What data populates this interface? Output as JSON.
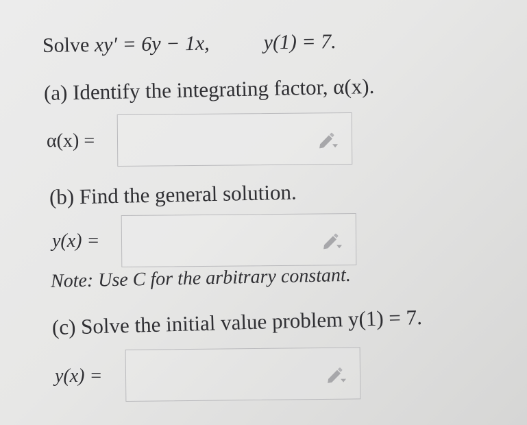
{
  "problem": {
    "prefix": "Solve ",
    "equation": "xy′ = 6y − 1x,",
    "initial_condition": "y(1) = 7."
  },
  "part_a": {
    "prompt": "(a) Identify the integrating factor, α(x).",
    "answer_label": "α(x) =",
    "answer_value": ""
  },
  "part_b": {
    "prompt": "(b) Find the general solution.",
    "answer_label": "y(x) =",
    "answer_value": "",
    "note": "Note: Use C for the arbitrary constant."
  },
  "part_c": {
    "prompt": "(c) Solve the initial value problem y(1) = 7.",
    "answer_label": "y(x) =",
    "answer_value": ""
  },
  "icons": {
    "answer_box_tool": "pencil-dropdown-icon"
  },
  "colors": {
    "text": "#2f2f33",
    "box_border": "#b9b9bc",
    "icon": "#a7a7aa"
  }
}
